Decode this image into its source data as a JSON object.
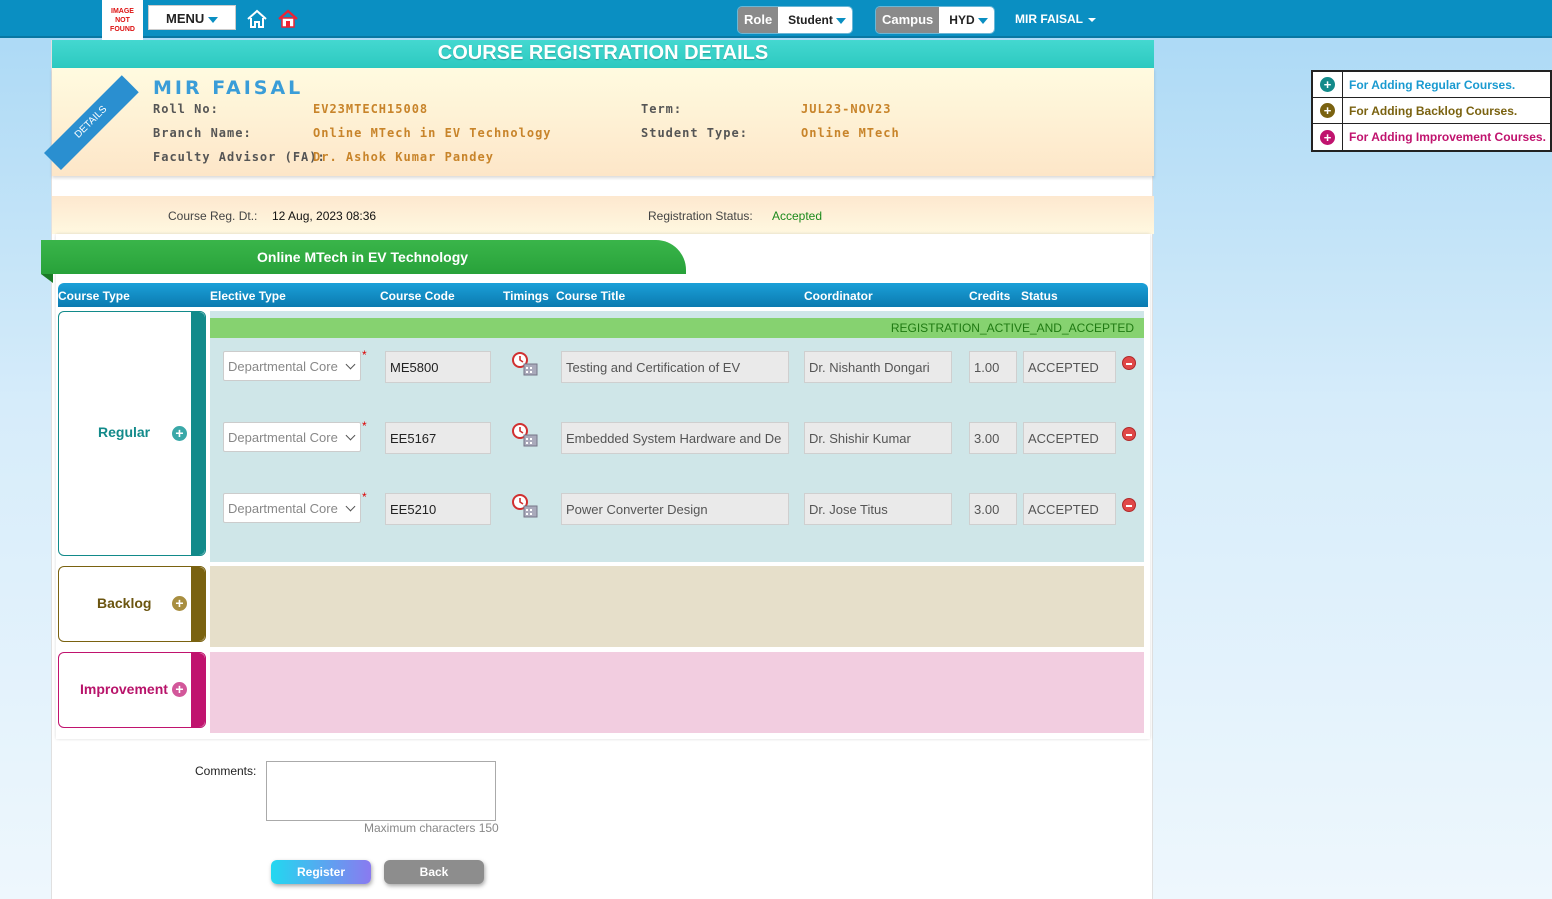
{
  "topbar": {
    "logo_text": "IMAGE NOT FOUND",
    "menu_label": "MENU",
    "role_label": "Role",
    "role_value": "Student",
    "campus_label": "Campus",
    "campus_value": "HYD",
    "user_name": "MIR FAISAL"
  },
  "page": {
    "title": "COURSE REGISTRATION DETAILS",
    "ribbon": "DETAILS"
  },
  "student": {
    "name": "MIR FAISAL",
    "roll_label": "Roll No:",
    "roll_value": "EV23MTECH15008",
    "branch_label": "Branch Name:",
    "branch_value": "Online MTech in EV Technology",
    "fa_label": "Faculty Advisor (FA):",
    "fa_value": "Dr. Ashok Kumar Pandey",
    "term_label": "Term:",
    "term_value": "JUL23-NOV23",
    "type_label": "Student Type:",
    "type_value": "Online MTech"
  },
  "registration": {
    "date_label": "Course Reg. Dt.:",
    "date_value": "12 Aug, 2023 08:36",
    "status_label": "Registration Status:",
    "status_value": "Accepted"
  },
  "program_tab": "Online MTech in EV Technology",
  "table_headers": {
    "course_type": "Course Type",
    "elective_type": "Elective Type",
    "course_code": "Course Code",
    "timings": "Timings",
    "course_title": "Course Title",
    "coordinator": "Coordinator",
    "credits": "Credits",
    "status": "Status"
  },
  "groups": {
    "regular": "Regular",
    "backlog": "Backlog",
    "improvement": "Improvement"
  },
  "regular_status": "REGISTRATION_ACTIVE_AND_ACCEPTED",
  "courses": [
    {
      "elective": "Departmental Core",
      "code": "ME5800",
      "title": "Testing and Certification of EV",
      "coordinator": "Dr. Nishanth Dongari",
      "credits": "1.00",
      "status": "ACCEPTED"
    },
    {
      "elective": "Departmental Core",
      "code": "EE5167",
      "title": "Embedded System Hardware and De",
      "coordinator": "Dr. Shishir Kumar",
      "credits": "3.00",
      "status": "ACCEPTED"
    },
    {
      "elective": "Departmental Core",
      "code": "EE5210",
      "title": "Power Converter Design",
      "coordinator": "Dr. Jose Titus",
      "credits": "3.00",
      "status": "ACCEPTED"
    }
  ],
  "comments": {
    "label": "Comments:",
    "hint": "Maximum characters 150"
  },
  "buttons": {
    "register": "Register",
    "back": "Back"
  },
  "legend": {
    "regular": "For Adding Regular Courses.",
    "backlog": "For Adding Backlog Courses.",
    "improvement": "For Adding Improvement Courses."
  },
  "colors": {
    "regular": "#128a8a",
    "backlog": "#7a6210",
    "improvement": "#c0136e",
    "regular_bg": "#cfe6e8",
    "backlog_bg": "#e6dfca",
    "improvement_bg": "#f2cde0"
  }
}
